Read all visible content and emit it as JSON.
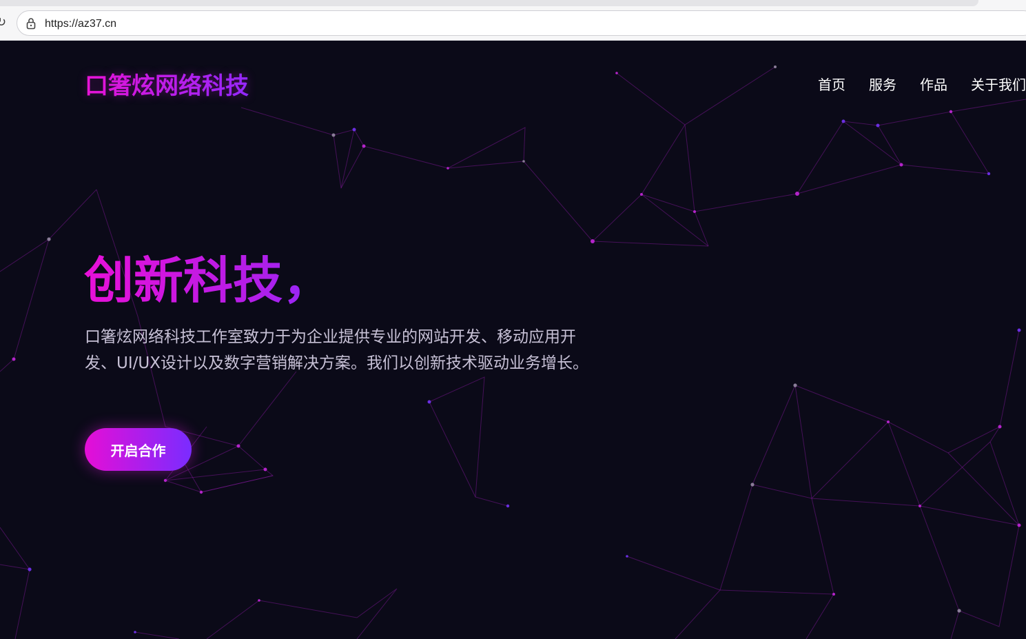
{
  "browser": {
    "url": "https://az37.cn"
  },
  "header": {
    "brand": "口箸炫网络科技",
    "nav": [
      "首页",
      "服务",
      "作品",
      "关于我们"
    ]
  },
  "hero": {
    "title": "创新科技，",
    "description": "口箸炫网络科技工作室致力于为企业提供专业的网站开发、移动应用开发、UI/UX设计以及数字营销解决方案。我们以创新技术驱动业务增长。",
    "cta_label": "开启合作"
  },
  "colors": {
    "background": "#0b0a18",
    "accent_pink": "#e810d8",
    "accent_purple": "#7a2cff",
    "nav_text": "#ffffff",
    "desc_text": "#c7c1d6"
  },
  "icons": [
    "reload-icon",
    "lock-icon"
  ]
}
